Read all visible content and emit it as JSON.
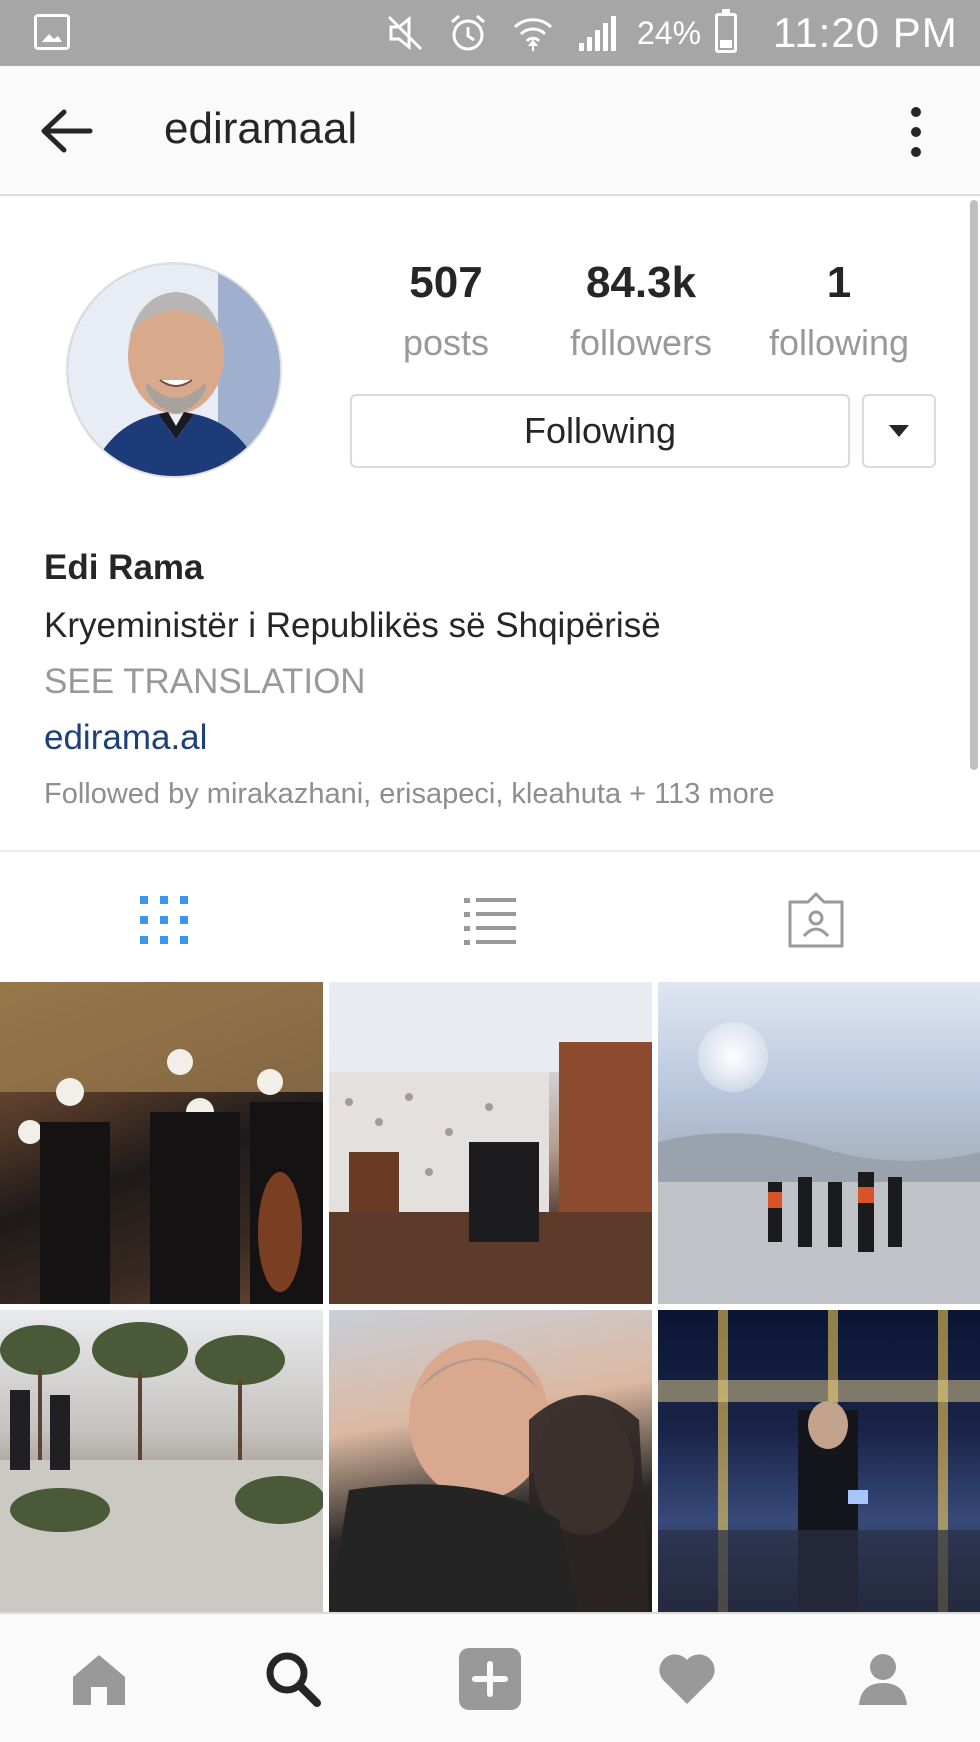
{
  "status_bar": {
    "battery": "24%",
    "time": "11:20 PM",
    "icons": [
      "gallery-icon",
      "mute-icon",
      "alarm-icon",
      "wifi-icon",
      "signal-icon",
      "battery-icon"
    ]
  },
  "header": {
    "username": "ediramaal",
    "back_icon": "arrow-left-icon",
    "menu_icon": "more-vertical-icon"
  },
  "profile": {
    "stats": [
      {
        "value": "507",
        "label": "posts"
      },
      {
        "value": "84.3k",
        "label": "followers"
      },
      {
        "value": "1",
        "label": "following"
      }
    ],
    "follow_button": "Following",
    "dropdown_icon": "triangle-down-icon",
    "name": "Edi Rama",
    "bio": "Kryeministër i Republikës së Shqipërisë",
    "see_translation": "SEE TRANSLATION",
    "website": "edirama.al",
    "followed_by": "Followed by mirakazhani, erisapeci, kleahuta + 113 more"
  },
  "tabs": [
    {
      "icon": "grid-icon",
      "active": true
    },
    {
      "icon": "list-icon",
      "active": false
    },
    {
      "icon": "tagged-photos-icon",
      "active": false
    }
  ],
  "colors": {
    "active_tab": "#3897f0",
    "inactive_icon": "#999999",
    "link": "#1e3f7a",
    "status_bar": "#a6a6a6"
  },
  "bottom_nav": [
    {
      "icon": "home-icon"
    },
    {
      "icon": "search-icon",
      "active": true
    },
    {
      "icon": "add-post-icon"
    },
    {
      "icon": "heart-icon"
    },
    {
      "icon": "profile-icon"
    }
  ]
}
